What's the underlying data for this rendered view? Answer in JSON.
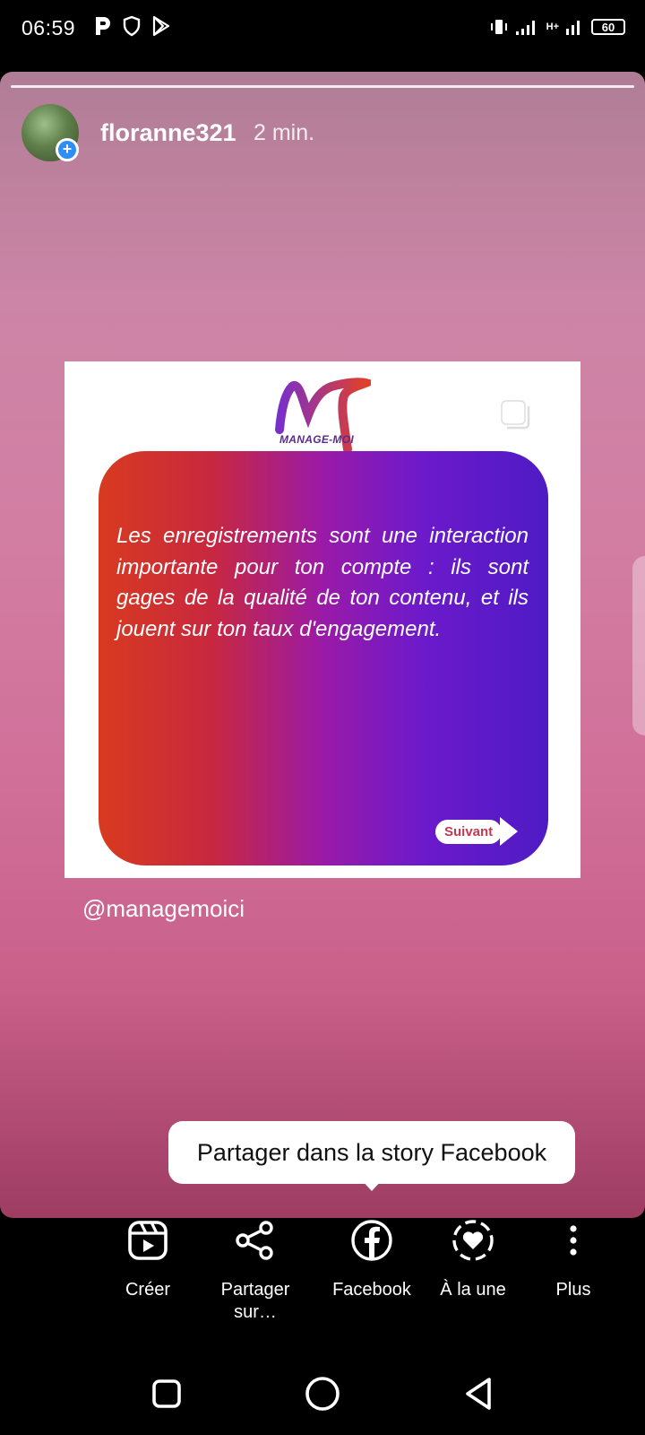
{
  "status_bar": {
    "time": "06:59",
    "battery": "60",
    "network": "H+",
    "icons_left": [
      "p-icon",
      "shield-icon",
      "play-store-icon"
    ],
    "icons_right": [
      "vibrate-icon",
      "signal-icon",
      "signal-icon",
      "battery-icon"
    ]
  },
  "story": {
    "username": "floranne321",
    "time_ago": "2 min.",
    "avatar_badge": "+",
    "post": {
      "logo_text": "MANAGE-MOI",
      "body_text": "Les enregistrements sont une interaction importante pour ton compte : ils sont gages de la qualité de ton contenu, et ils jouent sur ton taux d'engagement.",
      "next_label": "Suivant"
    },
    "mention": "@managemoici"
  },
  "tooltip": {
    "text": "Partager dans la story Facebook"
  },
  "share_bar": {
    "items": [
      {
        "label": "Créer",
        "icon": "reels-icon"
      },
      {
        "label": "Partager sur…",
        "icon": "share-icon"
      },
      {
        "label": "Facebook",
        "icon": "facebook-icon"
      },
      {
        "label": "À la une",
        "icon": "highlight-heart-icon"
      },
      {
        "label": "Plus",
        "icon": "more-vertical-icon"
      }
    ]
  },
  "nav_bar": {
    "buttons": [
      "recents-button",
      "home-button",
      "back-button"
    ]
  },
  "colors": {
    "story_top": "#b07d96",
    "story_bottom": "#9e3c62",
    "card_left": "#d83a20",
    "card_right": "#4e1bc4",
    "badge_blue": "#2d8ff5"
  }
}
